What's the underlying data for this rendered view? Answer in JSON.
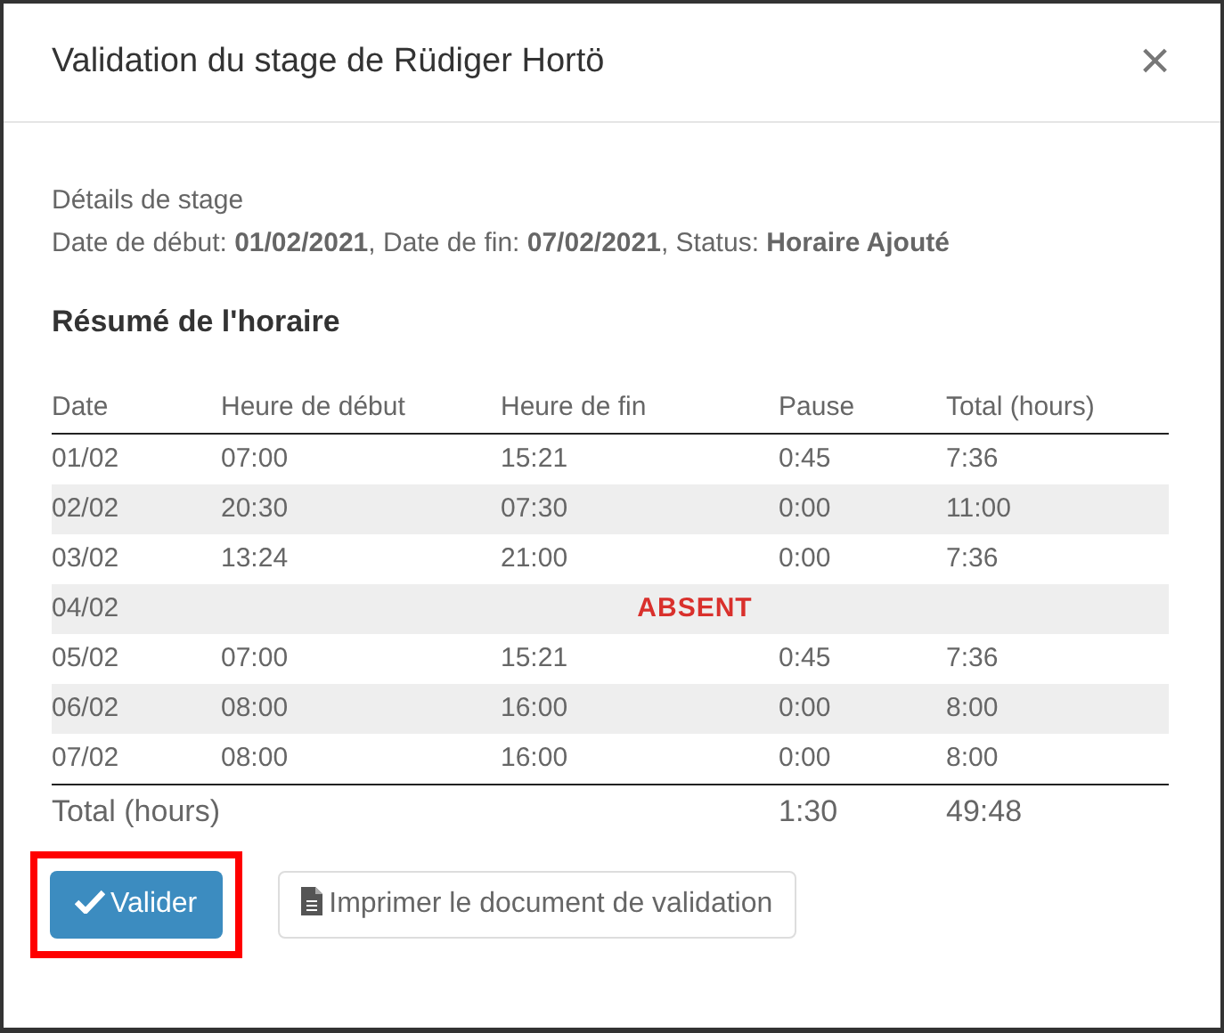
{
  "dialog": {
    "title": "Validation du stage de Rüdiger Hortö",
    "close": "×"
  },
  "details": {
    "heading": "Détails de stage",
    "line": "Date de début: **01/02/2021**, Date de fin: **07/02/2021**, Status: **Horaire Ajouté**"
  },
  "summary": {
    "title": "Résumé de l'horaire",
    "columns": [
      "Date",
      "Heure de début",
      "Heure de fin",
      "Pause",
      "Total (hours)"
    ],
    "rows": [
      {
        "kind": "shift",
        "cells": [
          "01/02",
          "07:00",
          "15:21",
          "0:45",
          "7:36"
        ]
      },
      {
        "kind": "shift",
        "cells": [
          "02/02",
          "20:30",
          "07:30",
          "0:00",
          "11:00"
        ]
      },
      {
        "kind": "shift",
        "cells": [
          "03/02",
          "13:24",
          "21:00",
          "0:00",
          "7:36"
        ]
      },
      {
        "kind": "absent",
        "cells": [
          "04/02"
        ],
        "note": "ABSENT"
      },
      {
        "kind": "shift",
        "cells": [
          "05/02",
          "07:00",
          "15:21",
          "0:45",
          "7:36"
        ]
      },
      {
        "kind": "shift",
        "cells": [
          "06/02",
          "08:00",
          "16:00",
          "0:00",
          "8:00"
        ]
      },
      {
        "kind": "shift",
        "cells": [
          "07/02",
          "08:00",
          "16:00",
          "0:00",
          "8:00"
        ]
      }
    ],
    "total": {
      "label": "Total (hours)",
      "pause": "1:30",
      "hours": "49:48"
    }
  },
  "buttons": [
    {
      "kind": "validate",
      "label": "Valider",
      "highlighted": true
    },
    {
      "kind": "print",
      "label": "Imprimer le document de validation",
      "highlighted": false
    }
  ]
}
